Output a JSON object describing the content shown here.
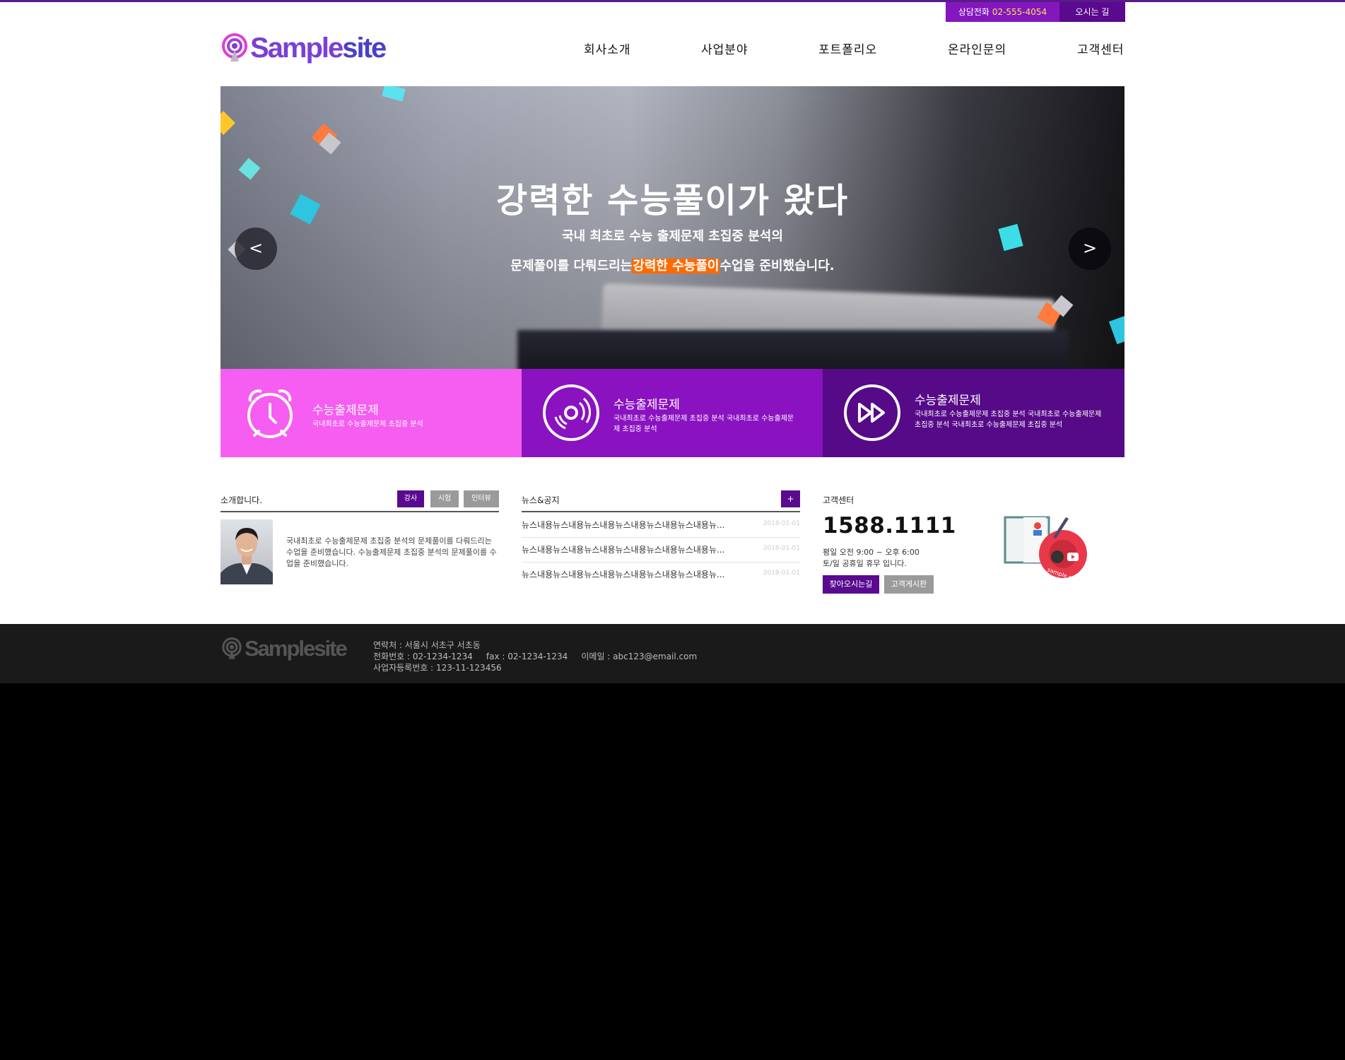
{
  "topbar": {
    "phone_label": "상담전화",
    "phone_number": "02-555-4054",
    "directions": "오시는 길"
  },
  "logo": {
    "part1": "Sample",
    "part2": "site"
  },
  "nav": [
    "회사소개",
    "사업분야",
    "포트폴리오",
    "온라인문의",
    "고객센터"
  ],
  "hero": {
    "title": "강력한 수능풀이가 왔다",
    "sub1": "국내 최초로 수능 출제문제 초집중 분석의",
    "sub2_pre": "문제풀이를 다뤄드리는",
    "sub2_highlight": "강력한 수능풀이",
    "sub2_post": "수업을 준비했습니다.",
    "prev": "<",
    "next": ">"
  },
  "features": [
    {
      "icon": "alarm-clock-icon",
      "title": "수능출제문제",
      "desc": "국내최초로 수능출제문제 초집중 분석",
      "color": "#f55ef0"
    },
    {
      "icon": "disc-icon",
      "title": "수능출제문제",
      "desc": "국내최초로 수능출제문제 초집중 분석 국내최초로 수능출제문제 초집중 분석",
      "color": "#8a12c1"
    },
    {
      "icon": "fast-forward-icon",
      "title": "수능출제문제",
      "desc": "국내최초로 수능출제문제 초집중 분석 국내최초로 수능출제문제 초집중 분석 국내최초로 수능출제문제 초집중 분석",
      "color": "#560a87"
    }
  ],
  "intro": {
    "title": "소개합니다.",
    "tabs": [
      "강사",
      "시험",
      "인터뷰"
    ],
    "text": "국내최초로 수능출제문제 초집중 분석의 문제풀이를 다뤄드리는 수업을 준비했습니다. 수능출제문제 초집중 분석의 문제풀이를 수업을 준비했습니다."
  },
  "news": {
    "title": "뉴스&공지",
    "plus": "+",
    "items": [
      {
        "text": "뉴스내용뉴스내용뉴스내용뉴스내용뉴스내용뉴스내용뉴...",
        "date": "2018-01-01"
      },
      {
        "text": "뉴스내용뉴스내용뉴스내용뉴스내용뉴스내용뉴스내용뉴...",
        "date": "2018-01-01"
      },
      {
        "text": "뉴스내용뉴스내용뉴스내용뉴스내용뉴스내용뉴스내용뉴...",
        "date": "2018-01-01"
      }
    ]
  },
  "cs": {
    "title": "고객센터",
    "number": "1588.1111",
    "hours1": "평일 오전 9:00 ~ 오후 6:00",
    "hours2": "토/일 공휴일 휴무 입니다.",
    "btn1": "찾아오시는길",
    "btn2": "고객게시판",
    "image_text": "sample movie"
  },
  "footer": {
    "logo": "Samplesite",
    "address": "연락처 : 서울시 서초구 서초동",
    "phone": "전화번호 : 02-1234-1234",
    "fax": "fax : 02-1234-1234",
    "email": "이메일 : abc123@email.com",
    "biz": "사업자등록번호 : 123-11-123456"
  },
  "colors": {
    "purple_dark": "#5a0a8e",
    "purple": "#8317bd",
    "pink": "#f55ef0",
    "highlight": "#ff6a00"
  }
}
